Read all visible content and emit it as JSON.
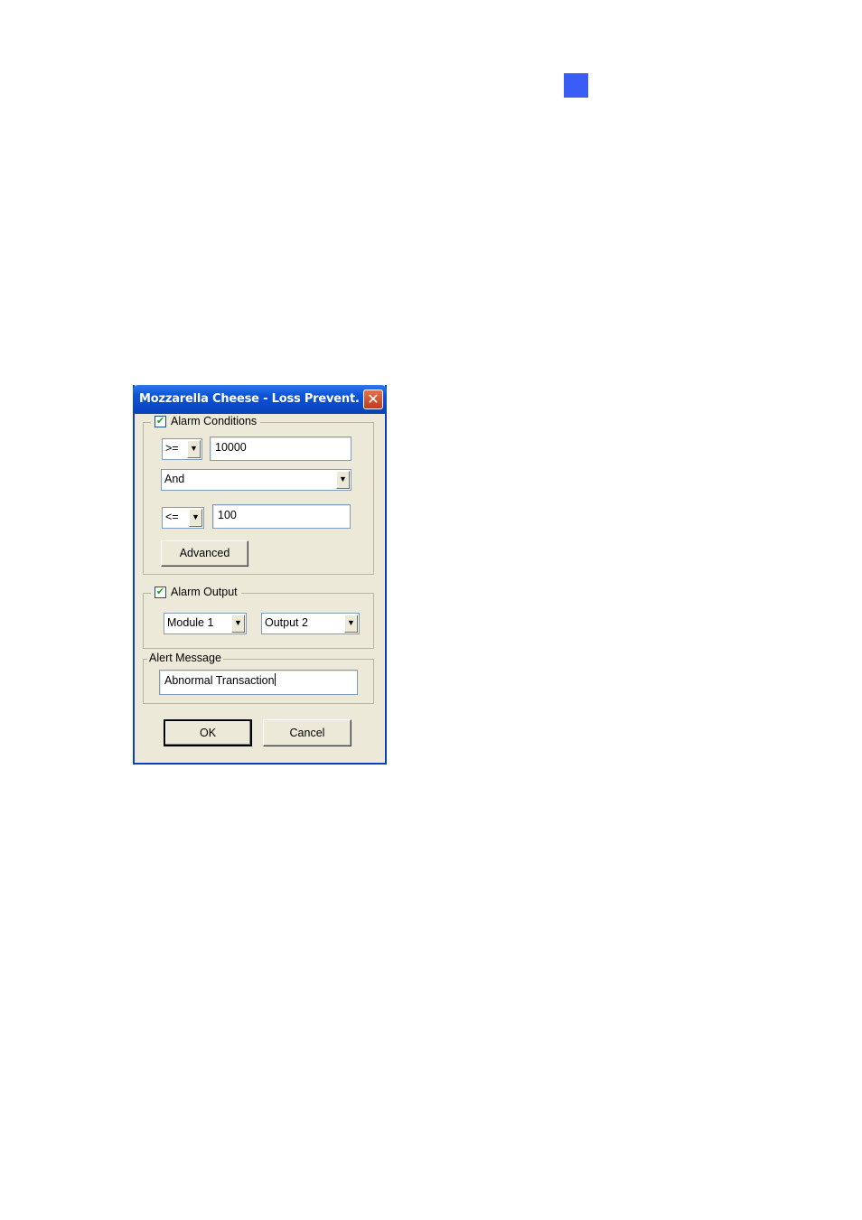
{
  "page": {
    "corner_square_color": "#3a5df6"
  },
  "dialog": {
    "title": "Mozzarella Cheese - Loss Prevent...",
    "close_label": "✕",
    "alarm_conditions": {
      "label": "Alarm Conditions",
      "checked": true,
      "condition1_operator": ">=",
      "condition1_value": "10000",
      "logic_operator": "And",
      "condition2_operator": "<=",
      "condition2_value": "100",
      "advanced_label": "Advanced"
    },
    "alarm_output": {
      "label": "Alarm Output",
      "checked": true,
      "module": "Module 1",
      "output": "Output 2"
    },
    "alert_message": {
      "label": "Alert Message",
      "value": "Abnormal Transaction"
    },
    "ok_label": "OK",
    "cancel_label": "Cancel"
  }
}
